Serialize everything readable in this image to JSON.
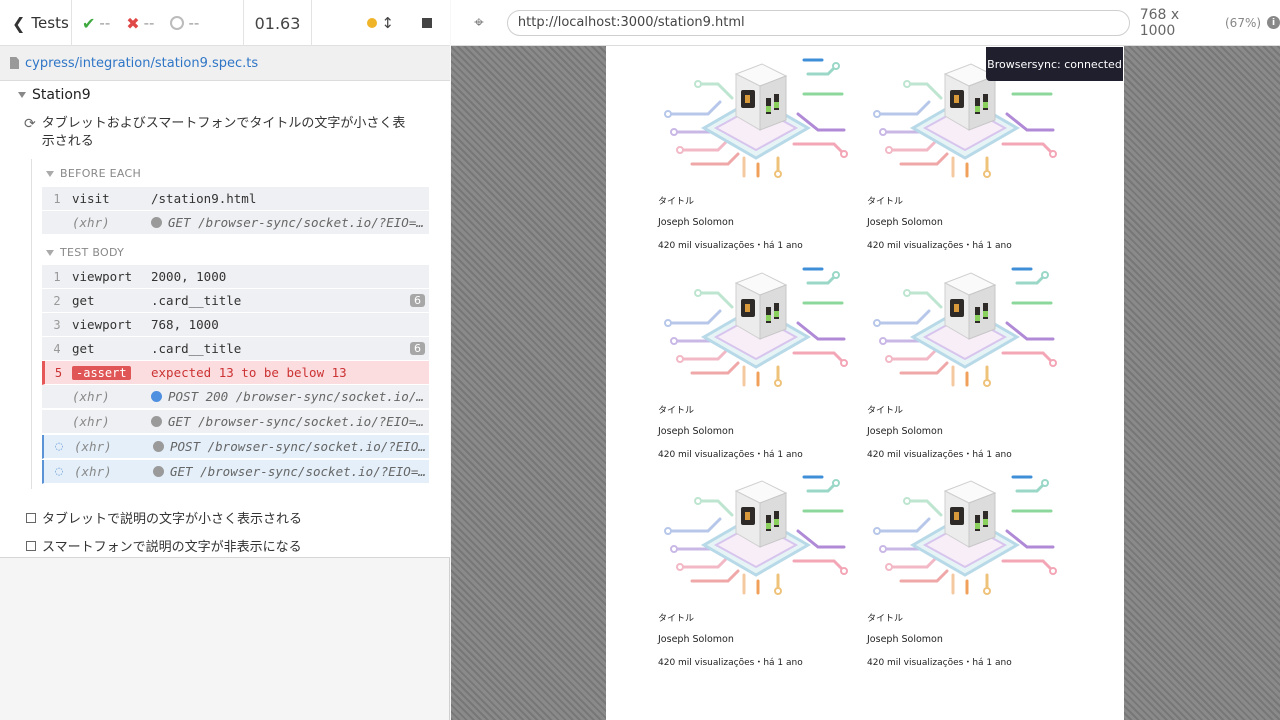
{
  "reporter": {
    "tests_label": "Tests",
    "passed": "--",
    "failed": "--",
    "pending": "--",
    "duration": "01.63",
    "spec_path": "cypress/integration/station9.spec.ts",
    "suite": "Station9",
    "active_test": "タブレットおよびスマートフォンでタイトルの文字が小さく表示される",
    "before_each_label": "BEFORE EACH",
    "test_body_label": "TEST BODY",
    "before_each": [
      {
        "num": "1",
        "name": "visit",
        "msg": "/station9.html"
      },
      {
        "num": "",
        "name": "(xhr)",
        "msg": "GET /browser-sync/socket.io/?EIO=…"
      }
    ],
    "body": [
      {
        "num": "1",
        "name": "viewport",
        "msg": "2000, 1000"
      },
      {
        "num": "2",
        "name": "get",
        "msg": ".card__title",
        "badge": "6"
      },
      {
        "num": "3",
        "name": "viewport",
        "msg": "768, 1000"
      },
      {
        "num": "4",
        "name": "get",
        "msg": ".card__title",
        "badge": "6"
      },
      {
        "num": "5",
        "name": "-assert",
        "msg": "expected 13 to be below 13"
      },
      {
        "num": "",
        "name": "(xhr)",
        "msg": "POST 200 /browser-sync/socket.io/…"
      },
      {
        "num": "",
        "name": "(xhr)",
        "msg": "GET /browser-sync/socket.io/?EIO=…"
      },
      {
        "num": "",
        "name": "(xhr)",
        "msg": "POST /browser-sync/socket.io/?EIO…"
      },
      {
        "num": "",
        "name": "(xhr)",
        "msg": "GET /browser-sync/socket.io/?EIO=…"
      }
    ],
    "other_tests": [
      "タブレットで説明の文字が小さく表示される",
      "スマートフォンで説明の文字が非表示になる"
    ]
  },
  "aut": {
    "url": "http://localhost:3000/station9.html",
    "viewport": "768 x 1000",
    "scale": "(67%)",
    "notification": "Browsersync: connected",
    "cards": [
      {
        "title": "タイトル",
        "author": "Joseph Solomon",
        "meta": "420 mil visualizações・há 1 ano"
      },
      {
        "title": "タイトル",
        "author": "Joseph Solomon",
        "meta": "420 mil visualizações・há 1 ano"
      },
      {
        "title": "タイトル",
        "author": "Joseph Solomon",
        "meta": "420 mil visualizações・há 1 ano"
      },
      {
        "title": "タイトル",
        "author": "Joseph Solomon",
        "meta": "420 mil visualizações・há 1 ano"
      },
      {
        "title": "タイトル",
        "author": "Joseph Solomon",
        "meta": "420 mil visualizações・há 1 ano"
      },
      {
        "title": "タイトル",
        "author": "Joseph Solomon",
        "meta": "420 mil visualizações・há 1 ano"
      }
    ]
  },
  "colors": {
    "pass": "#3fa93f",
    "fail": "#e04848",
    "link": "#2f76c7",
    "running": "#f0b429"
  },
  "icons": [
    "chevron-left-icon",
    "check-icon",
    "x-icon",
    "circle-icon",
    "dot-icon",
    "up-down-arrows-icon",
    "stop-icon",
    "file-icon",
    "refresh-icon",
    "crosshair-icon",
    "info-icon"
  ]
}
